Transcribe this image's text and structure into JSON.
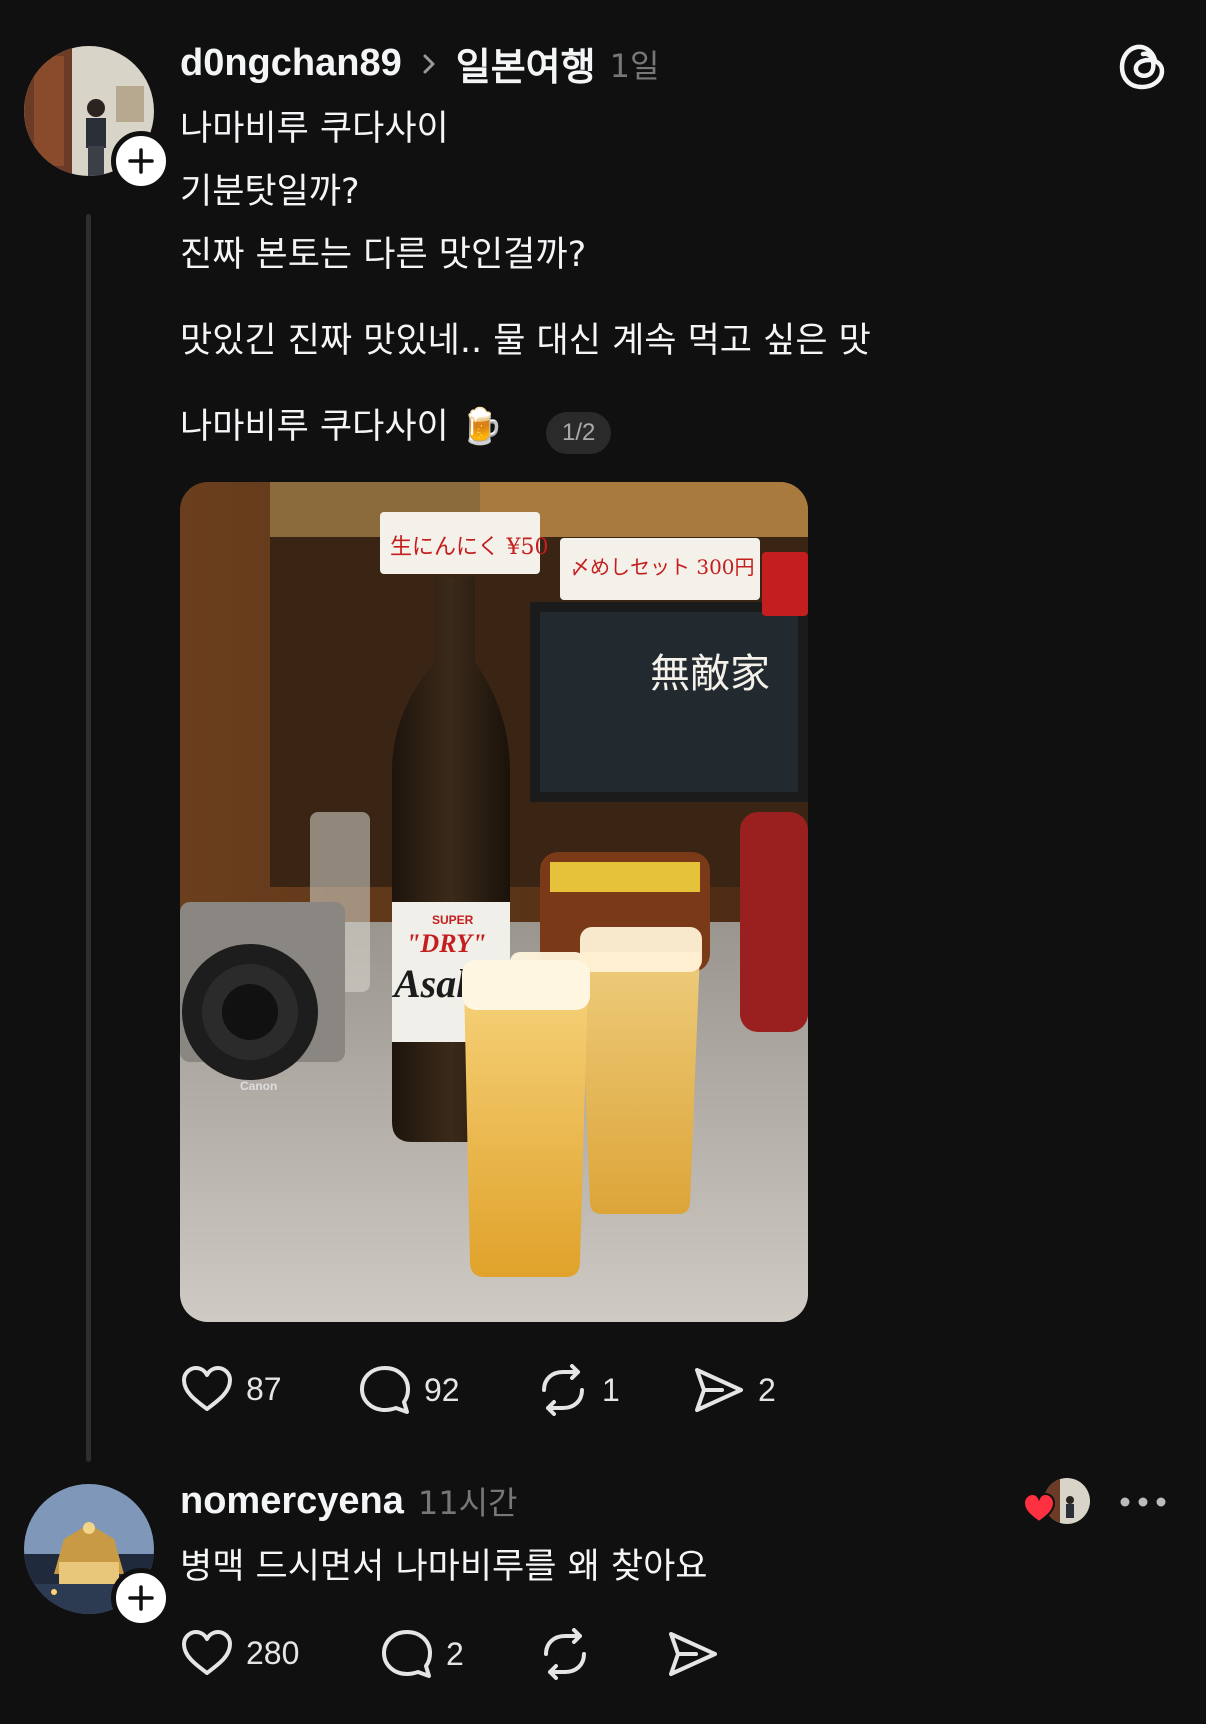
{
  "post": {
    "username": "d0ngchan89",
    "topic": "일본여행",
    "time": "1일",
    "lines": [
      "나마비루 쿠다사이",
      "기분탓일까?",
      "진짜 본토는 다른 맛인걸까?",
      "맛있긴 진짜 맛있네.. 물 대신 계속 먹고 싶은 맛",
      "나마비루 쿠다사이 🍺"
    ],
    "pager": "1/2",
    "photo_labels": {
      "brand": "Asahi",
      "dry": "\"DRY\"",
      "super": "SUPER",
      "camera": "Canon",
      "sign1": "生にんにく ¥50",
      "sign2": "〆めしセット 300円",
      "sign3": "無敵家"
    },
    "actions": {
      "likes": "87",
      "comments": "92",
      "reposts": "1",
      "shares": "2"
    }
  },
  "reply": {
    "username": "nomercyena",
    "time": "11시간",
    "text": "병맥 드시면서 나마비루를 왜 찾아요",
    "actions": {
      "likes": "280",
      "comments": "2"
    }
  },
  "icons": {
    "threads_logo": "threads-logo-icon",
    "heart": "heart-icon",
    "comment": "comment-icon",
    "repost": "repost-icon",
    "share": "share-icon",
    "more": "more-icon",
    "chevron": "chevron-right-icon",
    "plus": "plus-icon"
  },
  "colors": {
    "background": "#101010",
    "text": "#f3f5f7",
    "muted": "#777777",
    "like_red": "#ff3040"
  }
}
